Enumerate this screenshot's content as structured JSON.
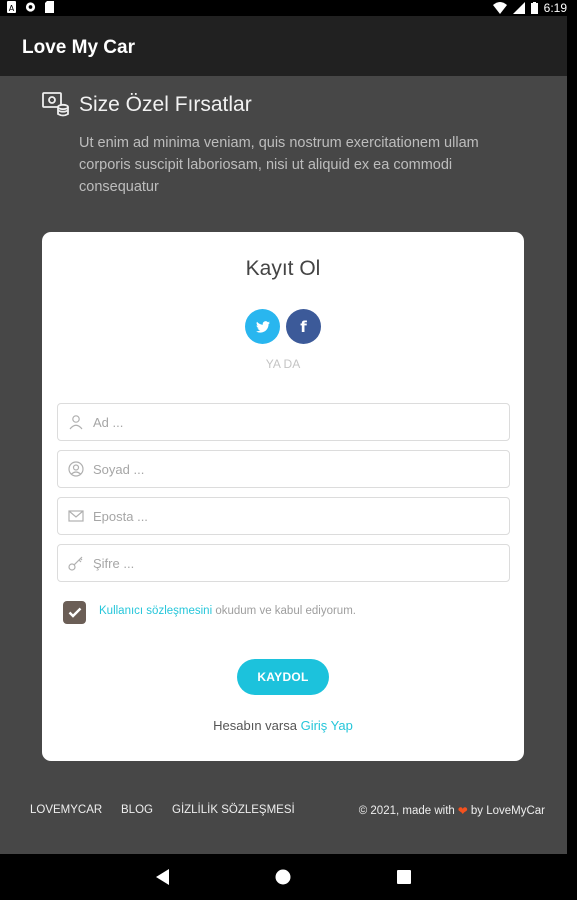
{
  "status_bar": {
    "time": "6:19"
  },
  "app_bar": {
    "title": "Love My Car"
  },
  "promo": {
    "title": "Size Özel Fırsatlar",
    "text": "Ut enim ad minima veniam, quis nostrum exercitationem ullam corporis suscipit laboriosam, nisi ut aliquid ex ea commodi consequatur"
  },
  "card": {
    "title": "Kayıt Ol",
    "or_text": "YA DA",
    "fields": {
      "name_placeholder": "Ad ...",
      "surname_placeholder": "Soyad ...",
      "email_placeholder": "Eposta ...",
      "password_placeholder": "Şifre ..."
    },
    "agreement": {
      "link": "Kullanıcı sözleşmesini",
      "text": " okudum ve kabul ediyorum."
    },
    "submit_label": "KAYDOL",
    "login_prompt": "Hesabın varsa ",
    "login_link": "Giriş Yap"
  },
  "footer": {
    "links": [
      "LOVEMYCAR",
      "BLOG",
      "GİZLİLİK SÖZLEŞMESİ"
    ],
    "copyright_prefix": "© 2021, made with",
    "copyright_suffix": "by LoveMyCar"
  },
  "colors": {
    "accent": "#1cc2dc",
    "twitter": "#29b6ef",
    "facebook": "#3c5a99",
    "heart": "#f4511e"
  }
}
